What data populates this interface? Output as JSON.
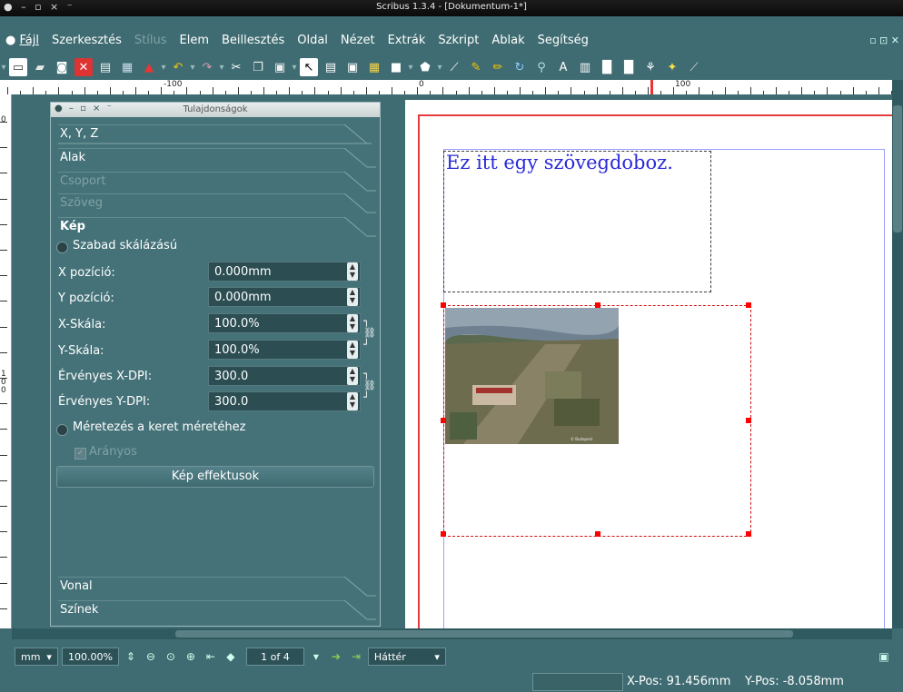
{
  "window": {
    "title": "Scribus 1.3.4 - [Dokumentum-1*]",
    "controls": "● – ▫ × ⁻"
  },
  "menubar": {
    "items": [
      {
        "label": "Fájl",
        "disabled": false
      },
      {
        "label": "Szerkesztés",
        "disabled": false
      },
      {
        "label": "Stílus",
        "disabled": true
      },
      {
        "label": "Elem",
        "disabled": false
      },
      {
        "label": "Beillesztés",
        "disabled": false
      },
      {
        "label": "Oldal",
        "disabled": false
      },
      {
        "label": "Nézet",
        "disabled": false
      },
      {
        "label": "Extrák",
        "disabled": false
      },
      {
        "label": "Szkript",
        "disabled": false
      },
      {
        "label": "Ablak",
        "disabled": false
      },
      {
        "label": "Segítség",
        "disabled": false
      }
    ],
    "window_controls": "▫ ⊡ ✕"
  },
  "toolbar": {
    "icons": [
      "new-document-icon",
      "open-icon",
      "save-icon",
      "close-icon",
      "print-icon",
      "preflight-icon",
      "pdf-export-icon",
      "undo-icon",
      "redo-icon",
      "cut-icon",
      "copy-icon",
      "paste-icon",
      "select-icon",
      "text-frame-icon",
      "image-frame-icon",
      "table-icon",
      "shape-icon",
      "polygon-icon",
      "line-icon",
      "bezier-icon",
      "freehand-icon",
      "rotate-icon",
      "zoom-icon",
      "edit-text-icon",
      "link-frames-icon",
      "unlink-frames-icon",
      "measure-icon",
      "copy-properties-icon",
      "eyedropper-icon"
    ]
  },
  "ruler": {
    "labels": [
      "-100",
      "0",
      "100"
    ]
  },
  "vruler": {
    "labels": [
      "0",
      "1",
      "0",
      "0"
    ]
  },
  "document": {
    "text_frame_content": "Ez itt egy szövegdoboz."
  },
  "properties": {
    "title": "Tulajdonságok",
    "sections": {
      "xyz": "X, Y, Z",
      "shape": "Alak",
      "group": "Csoport",
      "text": "Szöveg",
      "image": "Kép",
      "line": "Vonal",
      "colors": "Színek"
    },
    "free_scaling": "Szabad skálázású",
    "fields": [
      {
        "label": "X pozíció:",
        "value": "0.000mm"
      },
      {
        "label": "Y pozíció:",
        "value": "0.000mm"
      },
      {
        "label": "X-Skála:",
        "value": "100.0%"
      },
      {
        "label": "Y-Skála:",
        "value": "100.0%"
      },
      {
        "label": "Érvényes X-DPI:",
        "value": "300.0"
      },
      {
        "label": "Érvényes Y-DPI:",
        "value": "300.0"
      }
    ],
    "scale_to_frame": "Méretezés a keret méretéhez",
    "proportional": "Arányos",
    "effects_button": "Kép effektusok"
  },
  "navbar": {
    "unit": "mm",
    "zoom": "100.00%",
    "page": "1 of 4",
    "layer": "Háttér"
  },
  "statusbar": {
    "xpos": "X-Pos: 91.456mm",
    "ypos": "Y-Pos: -8.058mm"
  },
  "colors": {
    "accent": "#3f6c72",
    "page_margin": "#e53b3b",
    "text_color": "#2a2ad8"
  }
}
